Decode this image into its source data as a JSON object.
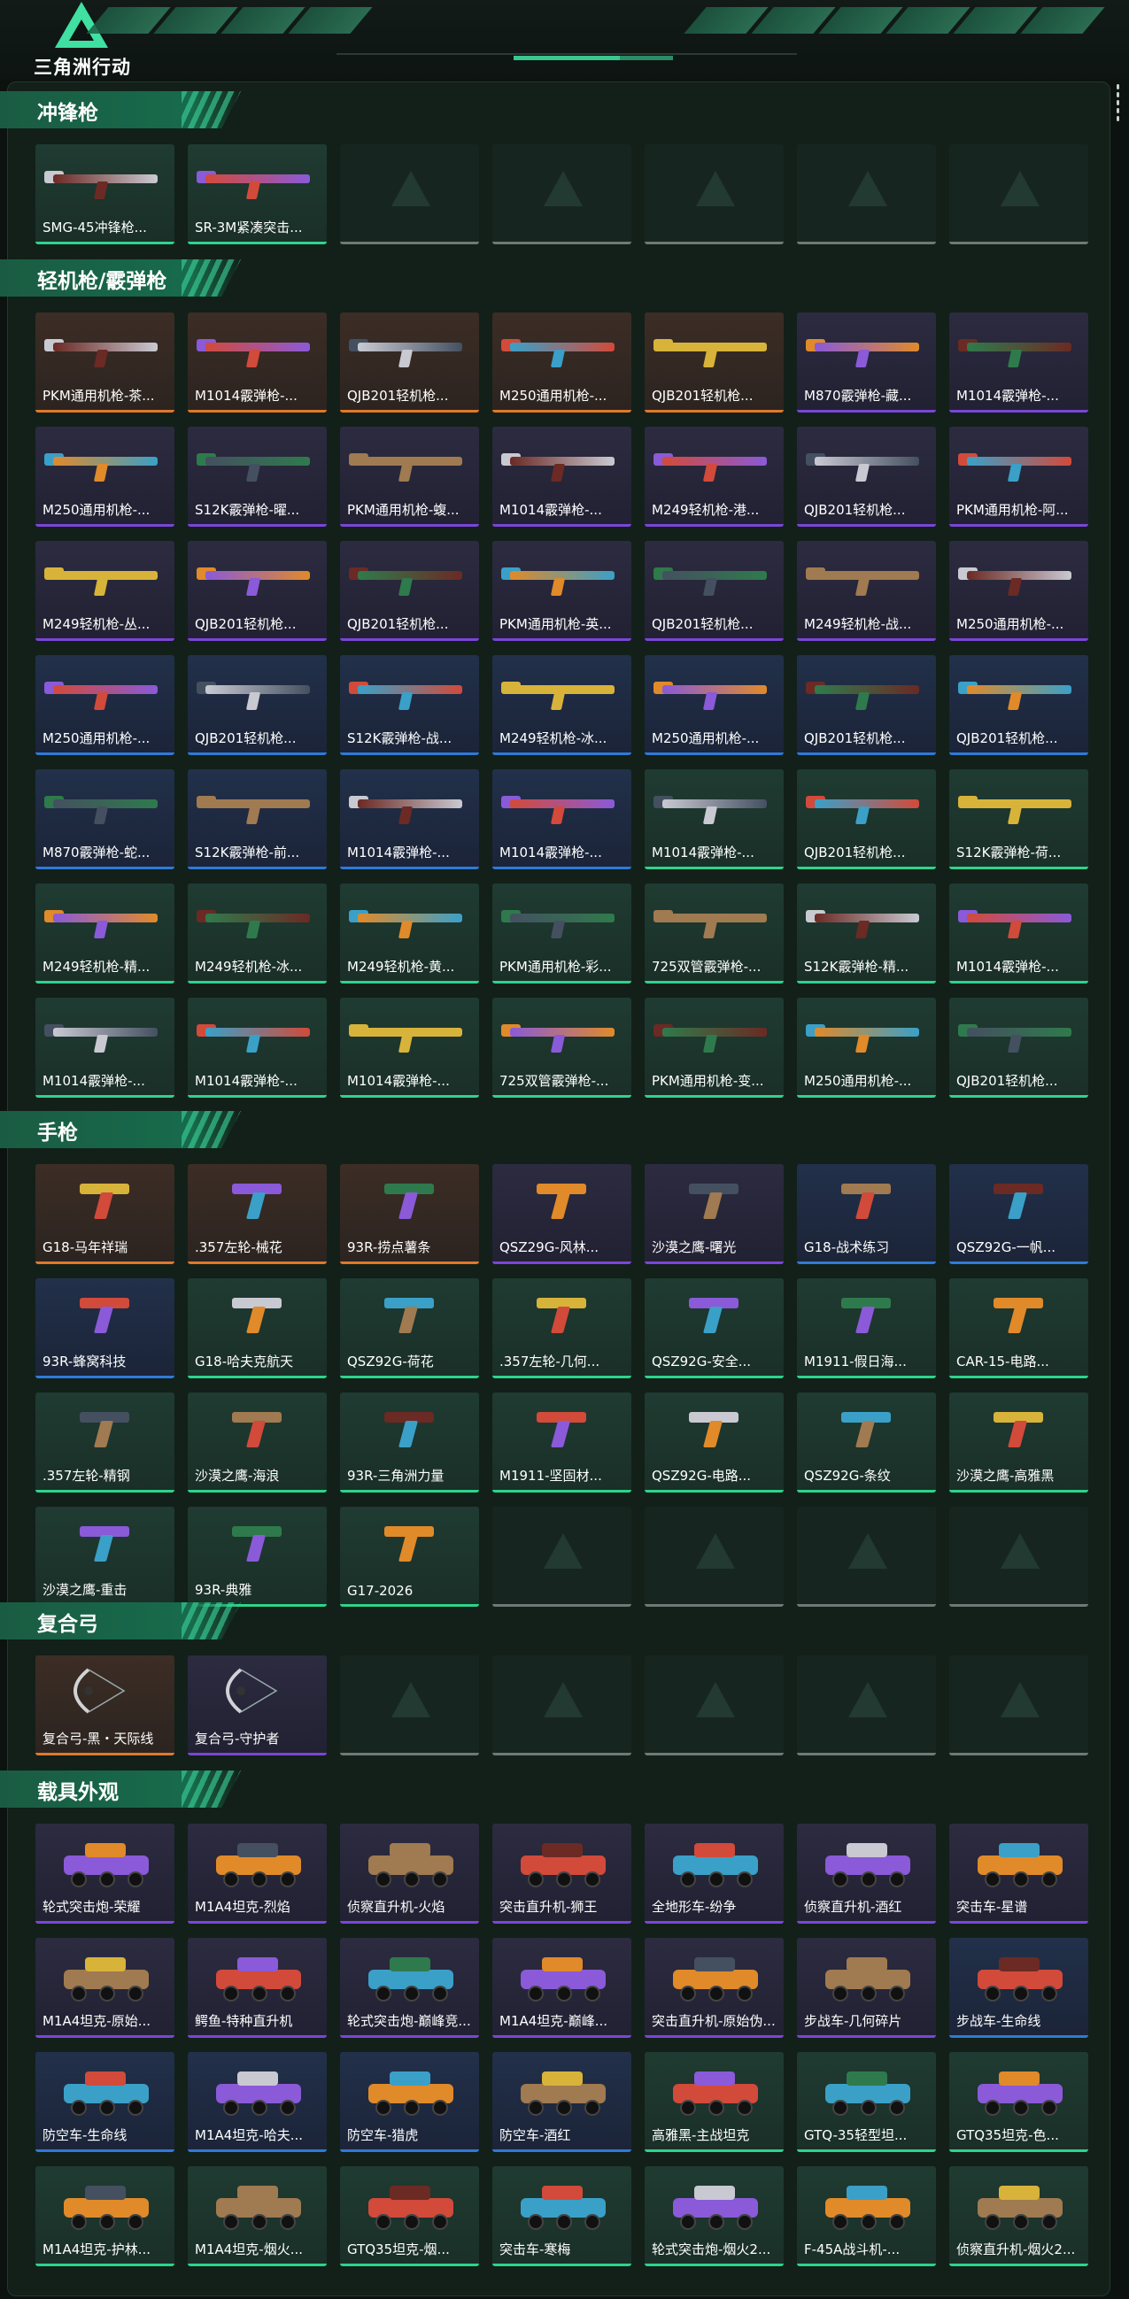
{
  "logo": {
    "text": "三角洲行动"
  },
  "sections": [
    {
      "title": "冲锋枪",
      "kind": "gun",
      "items": [
        {
          "label": "SMG-45冲锋枪...",
          "rarity": "green"
        },
        {
          "label": "SR-3M紧凑突击...",
          "rarity": "green"
        },
        {
          "label": "",
          "rarity": "empty"
        },
        {
          "label": "",
          "rarity": "empty"
        },
        {
          "label": "",
          "rarity": "empty"
        },
        {
          "label": "",
          "rarity": "empty"
        },
        {
          "label": "",
          "rarity": "empty"
        }
      ]
    },
    {
      "title": "轻机枪/霰弹枪",
      "kind": "gun",
      "items": [
        {
          "label": "PKM通用机枪-茶...",
          "rarity": "orange"
        },
        {
          "label": "M1014霰弹枪-...",
          "rarity": "orange"
        },
        {
          "label": "QJB201轻机枪...",
          "rarity": "orange"
        },
        {
          "label": "M250通用机枪-...",
          "rarity": "orange"
        },
        {
          "label": "QJB201轻机枪...",
          "rarity": "orange"
        },
        {
          "label": "M870霰弹枪-藏...",
          "rarity": "purple"
        },
        {
          "label": "M1014霰弹枪-...",
          "rarity": "purple"
        },
        {
          "label": "M250通用机枪-...",
          "rarity": "purple"
        },
        {
          "label": "S12K霰弹枪-曜...",
          "rarity": "purple"
        },
        {
          "label": "PKM通用机枪-蝮...",
          "rarity": "purple"
        },
        {
          "label": "M1014霰弹枪-...",
          "rarity": "purple"
        },
        {
          "label": "M249轻机枪-港...",
          "rarity": "purple"
        },
        {
          "label": "QJB201轻机枪...",
          "rarity": "purple"
        },
        {
          "label": "PKM通用机枪-阿...",
          "rarity": "purple"
        },
        {
          "label": "M249轻机枪-丛...",
          "rarity": "purple"
        },
        {
          "label": "QJB201轻机枪...",
          "rarity": "purple"
        },
        {
          "label": "QJB201轻机枪...",
          "rarity": "purple"
        },
        {
          "label": "PKM通用机枪-英...",
          "rarity": "purple"
        },
        {
          "label": "QJB201轻机枪...",
          "rarity": "purple"
        },
        {
          "label": "M249轻机枪-战...",
          "rarity": "purple"
        },
        {
          "label": "M250通用机枪-...",
          "rarity": "purple"
        },
        {
          "label": "M250通用机枪-...",
          "rarity": "blue"
        },
        {
          "label": "QJB201轻机枪...",
          "rarity": "blue"
        },
        {
          "label": "S12K霰弹枪-战...",
          "rarity": "blue"
        },
        {
          "label": "M249轻机枪-冰...",
          "rarity": "blue"
        },
        {
          "label": "M250通用机枪-...",
          "rarity": "blue"
        },
        {
          "label": "QJB201轻机枪...",
          "rarity": "blue"
        },
        {
          "label": "QJB201轻机枪...",
          "rarity": "blue"
        },
        {
          "label": "M870霰弹枪-蛇...",
          "rarity": "blue"
        },
        {
          "label": "S12K霰弹枪-前...",
          "rarity": "blue"
        },
        {
          "label": "M1014霰弹枪-...",
          "rarity": "blue"
        },
        {
          "label": "M1014霰弹枪-...",
          "rarity": "blue"
        },
        {
          "label": "M1014霰弹枪-...",
          "rarity": "green"
        },
        {
          "label": "QJB201轻机枪...",
          "rarity": "green"
        },
        {
          "label": "S12K霰弹枪-荷...",
          "rarity": "green"
        },
        {
          "label": "M249轻机枪-精...",
          "rarity": "green"
        },
        {
          "label": "M249轻机枪-冰...",
          "rarity": "green"
        },
        {
          "label": "M249轻机枪-黄...",
          "rarity": "green"
        },
        {
          "label": "PKM通用机枪-彩...",
          "rarity": "green"
        },
        {
          "label": "725双管霰弹枪-...",
          "rarity": "green"
        },
        {
          "label": "S12K霰弹枪-精...",
          "rarity": "green"
        },
        {
          "label": "M1014霰弹枪-...",
          "rarity": "green"
        },
        {
          "label": "M1014霰弹枪-...",
          "rarity": "green"
        },
        {
          "label": "M1014霰弹枪-...",
          "rarity": "green"
        },
        {
          "label": "M1014霰弹枪-...",
          "rarity": "green"
        },
        {
          "label": "725双管霰弹枪-...",
          "rarity": "green"
        },
        {
          "label": "PKM通用机枪-变...",
          "rarity": "green"
        },
        {
          "label": "M250通用机枪-...",
          "rarity": "green"
        },
        {
          "label": "QJB201轻机枪...",
          "rarity": "green"
        }
      ]
    },
    {
      "title": "手枪",
      "kind": "pistol",
      "items": [
        {
          "label": "G18-马年祥瑞",
          "rarity": "orange"
        },
        {
          "label": ".357左轮-械花",
          "rarity": "orange"
        },
        {
          "label": "93R-捞点薯条",
          "rarity": "orange"
        },
        {
          "label": "QSZ29G-风林...",
          "rarity": "purple"
        },
        {
          "label": "沙漠之鹰-曙光",
          "rarity": "purple"
        },
        {
          "label": "G18-战术练习",
          "rarity": "blue"
        },
        {
          "label": "QSZ92G-一帆...",
          "rarity": "blue"
        },
        {
          "label": "93R-蜂窝科技",
          "rarity": "blue"
        },
        {
          "label": "G18-哈夫克航天",
          "rarity": "green"
        },
        {
          "label": "QSZ92G-荷花",
          "rarity": "green"
        },
        {
          "label": ".357左轮-几何...",
          "rarity": "green"
        },
        {
          "label": "QSZ92G-安全...",
          "rarity": "green"
        },
        {
          "label": "M1911-假日海...",
          "rarity": "green"
        },
        {
          "label": "CAR-15-电路...",
          "rarity": "green"
        },
        {
          "label": ".357左轮-精钢",
          "rarity": "green"
        },
        {
          "label": "沙漠之鹰-海浪",
          "rarity": "green"
        },
        {
          "label": "93R-三角洲力量",
          "rarity": "green"
        },
        {
          "label": "M1911-坚固材...",
          "rarity": "green"
        },
        {
          "label": "QSZ92G-电路...",
          "rarity": "green"
        },
        {
          "label": "QSZ92G-条纹",
          "rarity": "green"
        },
        {
          "label": "沙漠之鹰-高雅黑",
          "rarity": "green"
        },
        {
          "label": "沙漠之鹰-重击",
          "rarity": "green"
        },
        {
          "label": "93R-典雅",
          "rarity": "green"
        },
        {
          "label": "G17-2026",
          "rarity": "green"
        },
        {
          "label": "",
          "rarity": "empty"
        },
        {
          "label": "",
          "rarity": "empty"
        },
        {
          "label": "",
          "rarity": "empty"
        },
        {
          "label": "",
          "rarity": "empty"
        }
      ]
    },
    {
      "title": "复合弓",
      "kind": "bow",
      "items": [
        {
          "label": "复合弓-黑・天际线",
          "rarity": "orange"
        },
        {
          "label": "复合弓-守护者",
          "rarity": "purple"
        },
        {
          "label": "",
          "rarity": "empty"
        },
        {
          "label": "",
          "rarity": "empty"
        },
        {
          "label": "",
          "rarity": "empty"
        },
        {
          "label": "",
          "rarity": "empty"
        },
        {
          "label": "",
          "rarity": "empty"
        }
      ]
    },
    {
      "title": "载具外观",
      "kind": "vehicle",
      "items": [
        {
          "label": "轮式突击炮-荣耀",
          "rarity": "purple"
        },
        {
          "label": "M1A4坦克-烈焰",
          "rarity": "purple"
        },
        {
          "label": "侦察直升机-火焰",
          "rarity": "purple"
        },
        {
          "label": "突击直升机-狮王",
          "rarity": "purple"
        },
        {
          "label": "全地形车-纷争",
          "rarity": "purple"
        },
        {
          "label": "侦察直升机-酒红",
          "rarity": "purple"
        },
        {
          "label": "突击车-星谱",
          "rarity": "purple"
        },
        {
          "label": "M1A4坦克-原始...",
          "rarity": "purple"
        },
        {
          "label": "鳄鱼-特种直升机",
          "rarity": "purple"
        },
        {
          "label": "轮式突击炮-巅峰竞...",
          "rarity": "purple"
        },
        {
          "label": "M1A4坦克-巅峰...",
          "rarity": "purple"
        },
        {
          "label": "突击直升机-原始伪...",
          "rarity": "purple"
        },
        {
          "label": "步战车-几何碎片",
          "rarity": "purple"
        },
        {
          "label": "步战车-生命线",
          "rarity": "blue"
        },
        {
          "label": "防空车-生命线",
          "rarity": "blue"
        },
        {
          "label": "M1A4坦克-哈夫...",
          "rarity": "blue"
        },
        {
          "label": "防空车-猎虎",
          "rarity": "blue"
        },
        {
          "label": "防空车-酒红",
          "rarity": "blue"
        },
        {
          "label": "高雅黑-主战坦克",
          "rarity": "green"
        },
        {
          "label": "GTQ-35轻型坦...",
          "rarity": "green"
        },
        {
          "label": "GTQ35坦克-色...",
          "rarity": "green"
        },
        {
          "label": "M1A4坦克-护林...",
          "rarity": "green"
        },
        {
          "label": "M1A4坦克-烟火...",
          "rarity": "green"
        },
        {
          "label": "GTQ35坦克-烟...",
          "rarity": "green"
        },
        {
          "label": "突击车-寒梅",
          "rarity": "green"
        },
        {
          "label": "轮式突击炮-烟火2...",
          "rarity": "green"
        },
        {
          "label": "F-45A战斗机-...",
          "rarity": "green"
        },
        {
          "label": "侦察直升机-烟火2...",
          "rarity": "green"
        }
      ]
    }
  ],
  "colors": {
    "orange": "#e0782a",
    "purple": "#7a46d8",
    "blue": "#2f7ad8",
    "green": "#2dd48c"
  }
}
